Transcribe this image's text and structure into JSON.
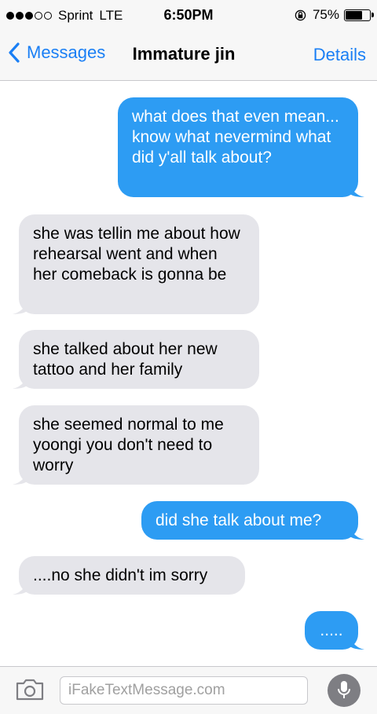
{
  "status_bar": {
    "carrier": "Sprint",
    "network": "LTE",
    "time": "6:50PM",
    "battery_text": "75%",
    "battery_level": 0.75,
    "signal_bars_filled": 3,
    "signal_bars_total": 5
  },
  "nav": {
    "back_label": "Messages",
    "contact_name": "Immature jin",
    "details_label": "Details"
  },
  "messages": [
    {
      "side": "sent",
      "text": "what does that even mean... know what nevermind what did y'all talk about?"
    },
    {
      "side": "received",
      "text": "she was tellin me about how rehearsal went and when her comeback is gonna be"
    },
    {
      "side": "received",
      "text": "she talked about her new tattoo and her family"
    },
    {
      "side": "received",
      "text": "she seemed normal to me yoongi you don't need to worry"
    },
    {
      "side": "sent",
      "text": "did she talk about me?"
    },
    {
      "side": "received",
      "text": "....no she didn't im sorry"
    },
    {
      "side": "sent",
      "text": "....."
    }
  ],
  "composer": {
    "placeholder": "iFakeTextMessage.com"
  },
  "colors": {
    "accent": "#1a7ff5",
    "sent_bubble": "#2d9cf3",
    "received_bubble": "#e5e5ea"
  },
  "icons": [
    "back-chevron-icon",
    "lock-rotation-icon",
    "battery-icon",
    "camera-icon",
    "microphone-icon"
  ]
}
